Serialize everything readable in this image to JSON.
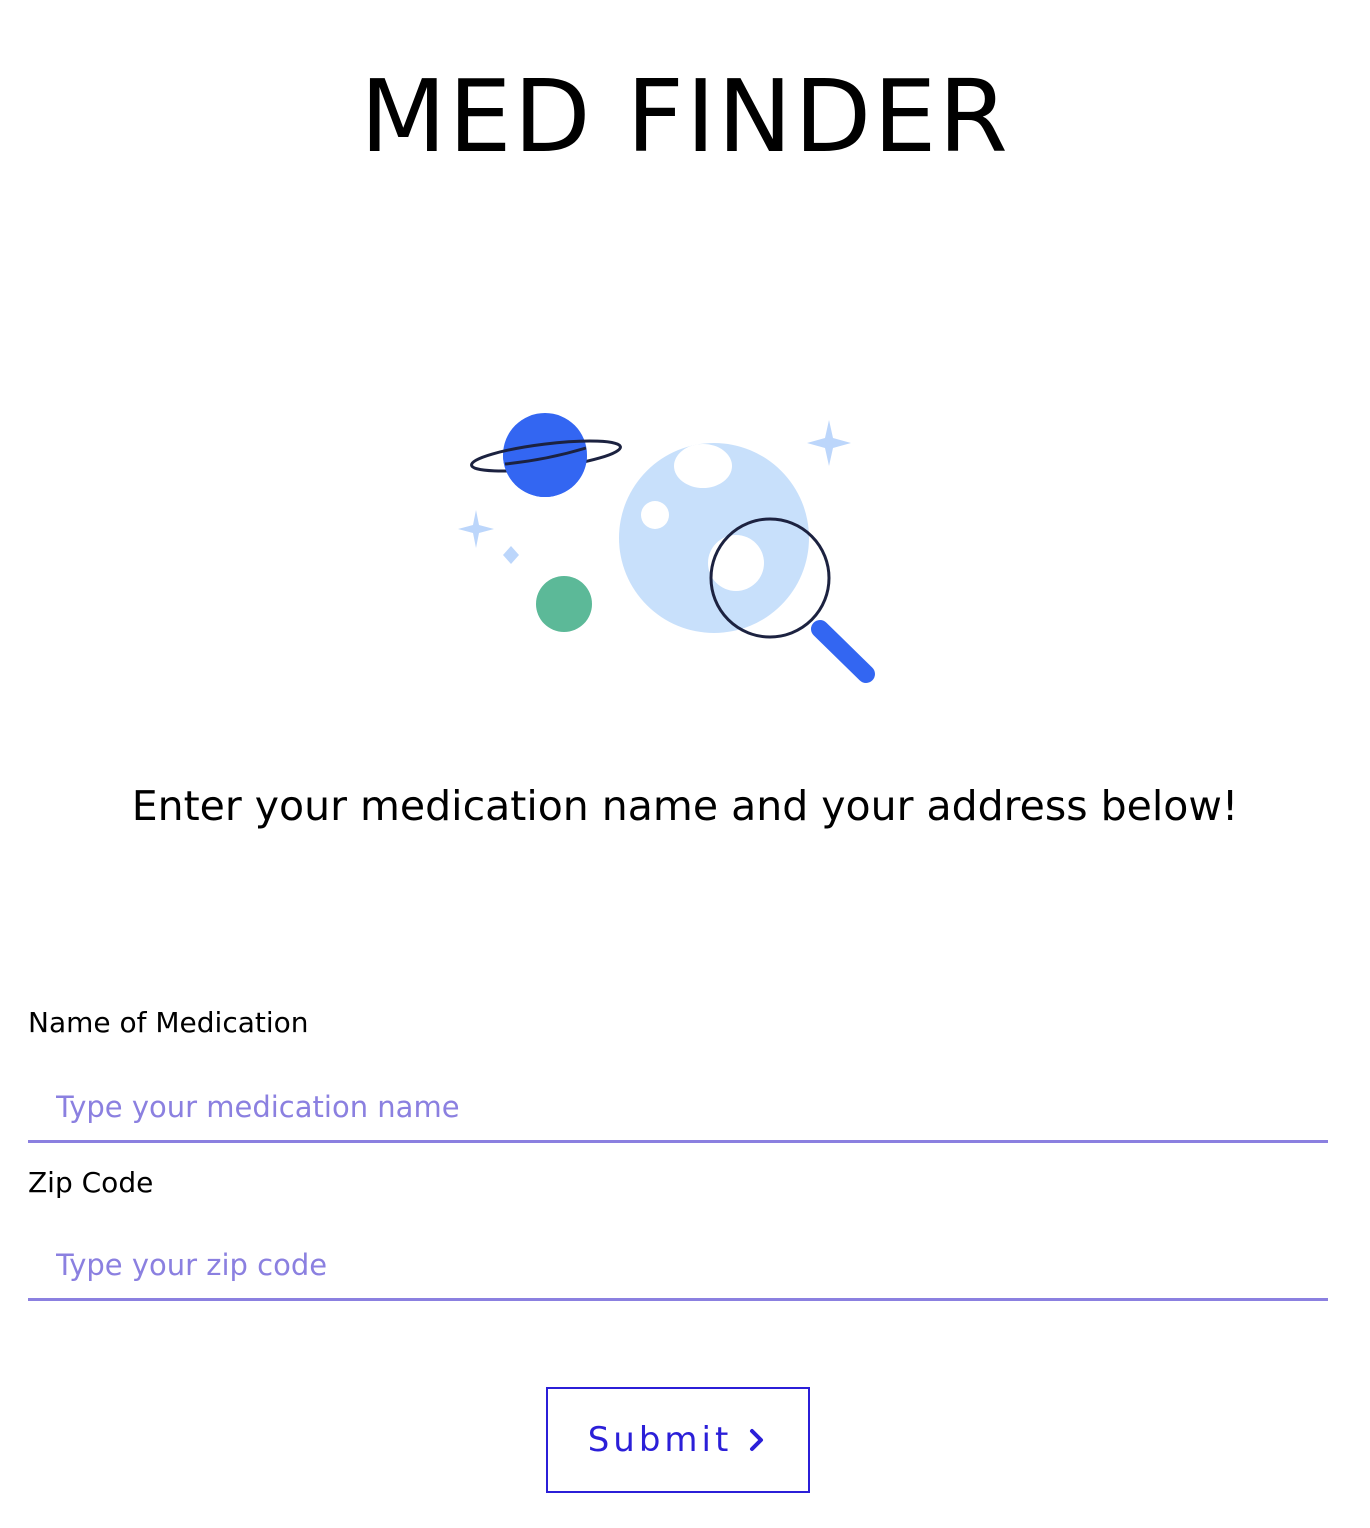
{
  "header": {
    "title": "MED FINDER"
  },
  "illustration": {
    "icon": "planet-search-illustration",
    "colors": {
      "planet_blue": "#3366f2",
      "moon_light": "#c8e0fb",
      "green_dot": "#5cb998",
      "star_light": "#bcd6fb",
      "outline_dark": "#1c2240"
    }
  },
  "intro": {
    "text": "Enter your medication name and your address below!"
  },
  "form": {
    "medication": {
      "label": "Name of Medication",
      "placeholder": "Type your medication name",
      "value": ""
    },
    "zip": {
      "label": "Zip Code",
      "placeholder": "Type your zip code",
      "value": ""
    },
    "submit": {
      "label": "Submit",
      "icon": "chevron-right-icon"
    }
  },
  "colors": {
    "accent": "#8b80e0",
    "button": "#2b1fd8",
    "text": "#000000",
    "background": "#ffffff"
  }
}
